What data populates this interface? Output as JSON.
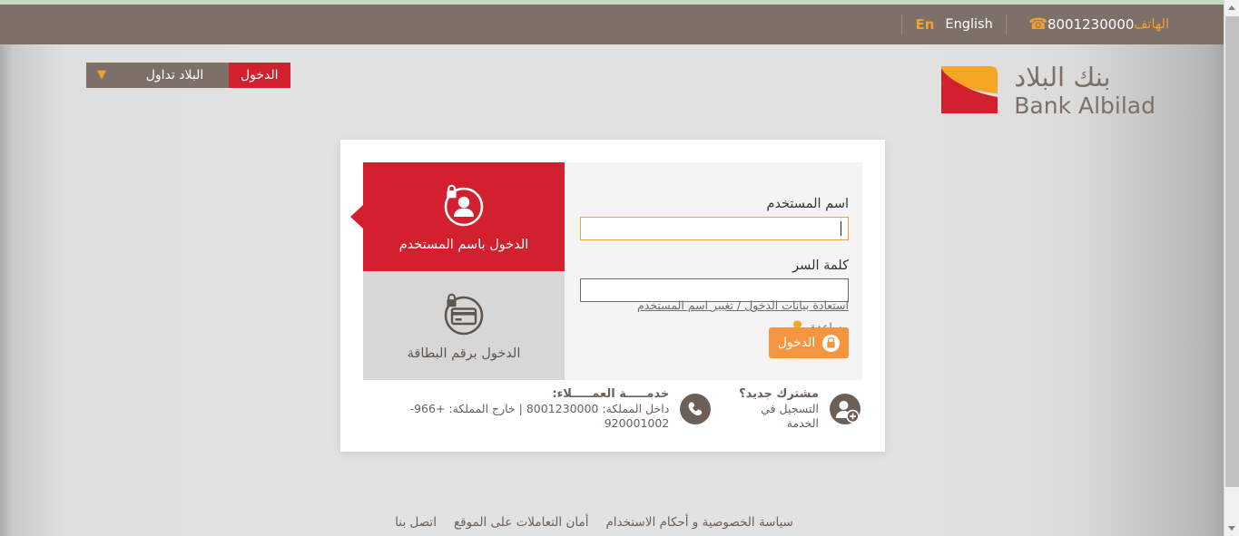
{
  "utility_bar": {
    "phone_label": "الهاتف",
    "phone_number": "8001230000",
    "phone_icon": "phone-icon",
    "lang_full": "English",
    "lang_short": "En"
  },
  "header": {
    "login_button": "الدخول",
    "tadawul_button": "البلاد تداول",
    "chevron_icon": "chevron-down-icon",
    "logo_arabic": "بنك البلاد",
    "logo_english": "Bank Albilad",
    "logo_colors": {
      "orange": "#f5a623",
      "red": "#d2202f",
      "text": "#7d7068"
    }
  },
  "login_form": {
    "username_label": "اسم المستخدم",
    "username_value": "",
    "username_placeholder": "",
    "password_label": "كلمة السر",
    "password_value": "",
    "password_placeholder": "",
    "recover_link": "استعادة بيانات الدخول / تغيير اسم المستخدم",
    "help_link": "مساعدة",
    "help_icon": "lightbulb-icon",
    "submit_label": "الدخول",
    "submit_icon": "lock-icon",
    "accent_focus_color": "#e8a33d",
    "submit_color": "#f5953f"
  },
  "tabs": [
    {
      "label": "الدخول باسم المستخدم",
      "icon": "user-lock-icon",
      "active": true,
      "color": "#d2202f"
    },
    {
      "label": "الدخول برقم البطاقة",
      "icon": "card-lock-icon",
      "active": false,
      "color": "#d7d7d7"
    }
  ],
  "card_footer": {
    "register": {
      "icon": "user-add-icon",
      "title": "مشترك جديد؟",
      "subtitle": "التسجيل في الخدمة"
    },
    "support": {
      "icon": "phone-circle-icon",
      "title": "خدمـــــة العمـــــلاء:",
      "subtitle": "داخل المملكة: 8001230000  |  خارج المملكة: +966-920001002"
    }
  },
  "page_footer": {
    "links": [
      "سياسة الخصوصية و أحكام الاستخدام",
      "أمان التعاملات على الموقع",
      "اتصل بنا"
    ]
  },
  "scrollbar": {
    "up_icon": "scroll-up-arrow-icon",
    "down_icon": "scroll-down-arrow-icon",
    "thumb": "scrollbar-thumb"
  }
}
